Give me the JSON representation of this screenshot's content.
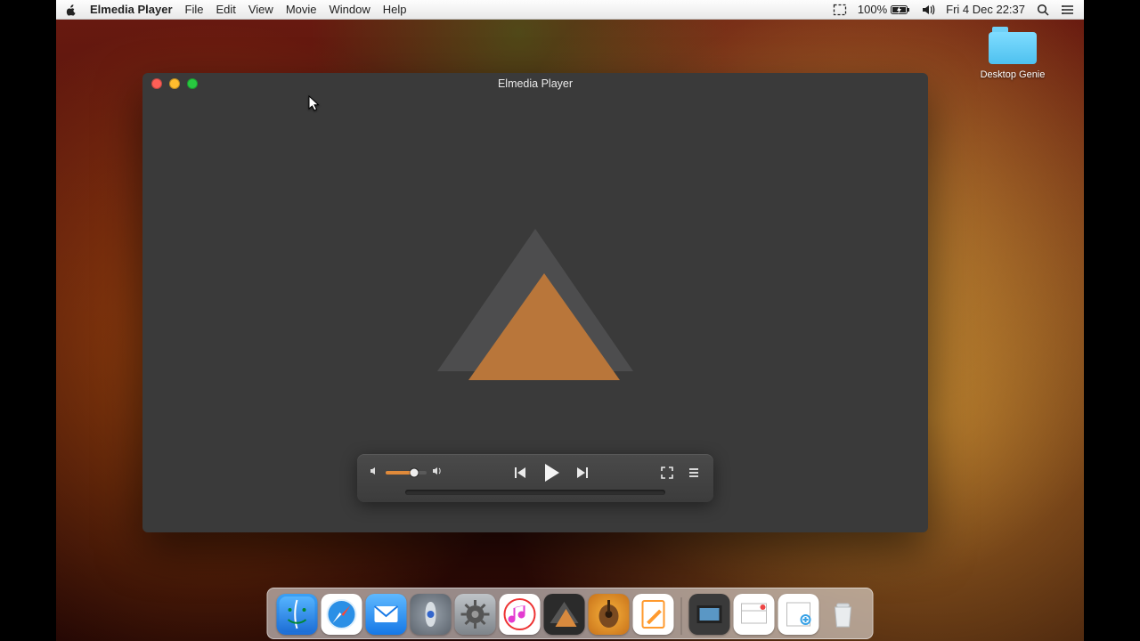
{
  "menubar": {
    "app_name": "Elmedia Player",
    "items": [
      "File",
      "Edit",
      "View",
      "Movie",
      "Window",
      "Help"
    ],
    "battery": "100%",
    "clock": "Fri 4 Dec  22:37"
  },
  "desktop_item": {
    "label": "Desktop Genie"
  },
  "window": {
    "title": "Elmedia Player",
    "volume_pct": 70,
    "seek_pct": 0
  },
  "colors": {
    "accent": "#e08a3a",
    "window_bg": "#3a3a3a"
  },
  "dock": {
    "items": [
      "finder",
      "safari",
      "mail",
      "launchpad",
      "system-preferences",
      "itunes",
      "elmedia-player",
      "garageband",
      "pages"
    ],
    "right_items": [
      "downloads-stack-1",
      "downloads-stack-2",
      "downloads-stack-3",
      "trash"
    ]
  }
}
